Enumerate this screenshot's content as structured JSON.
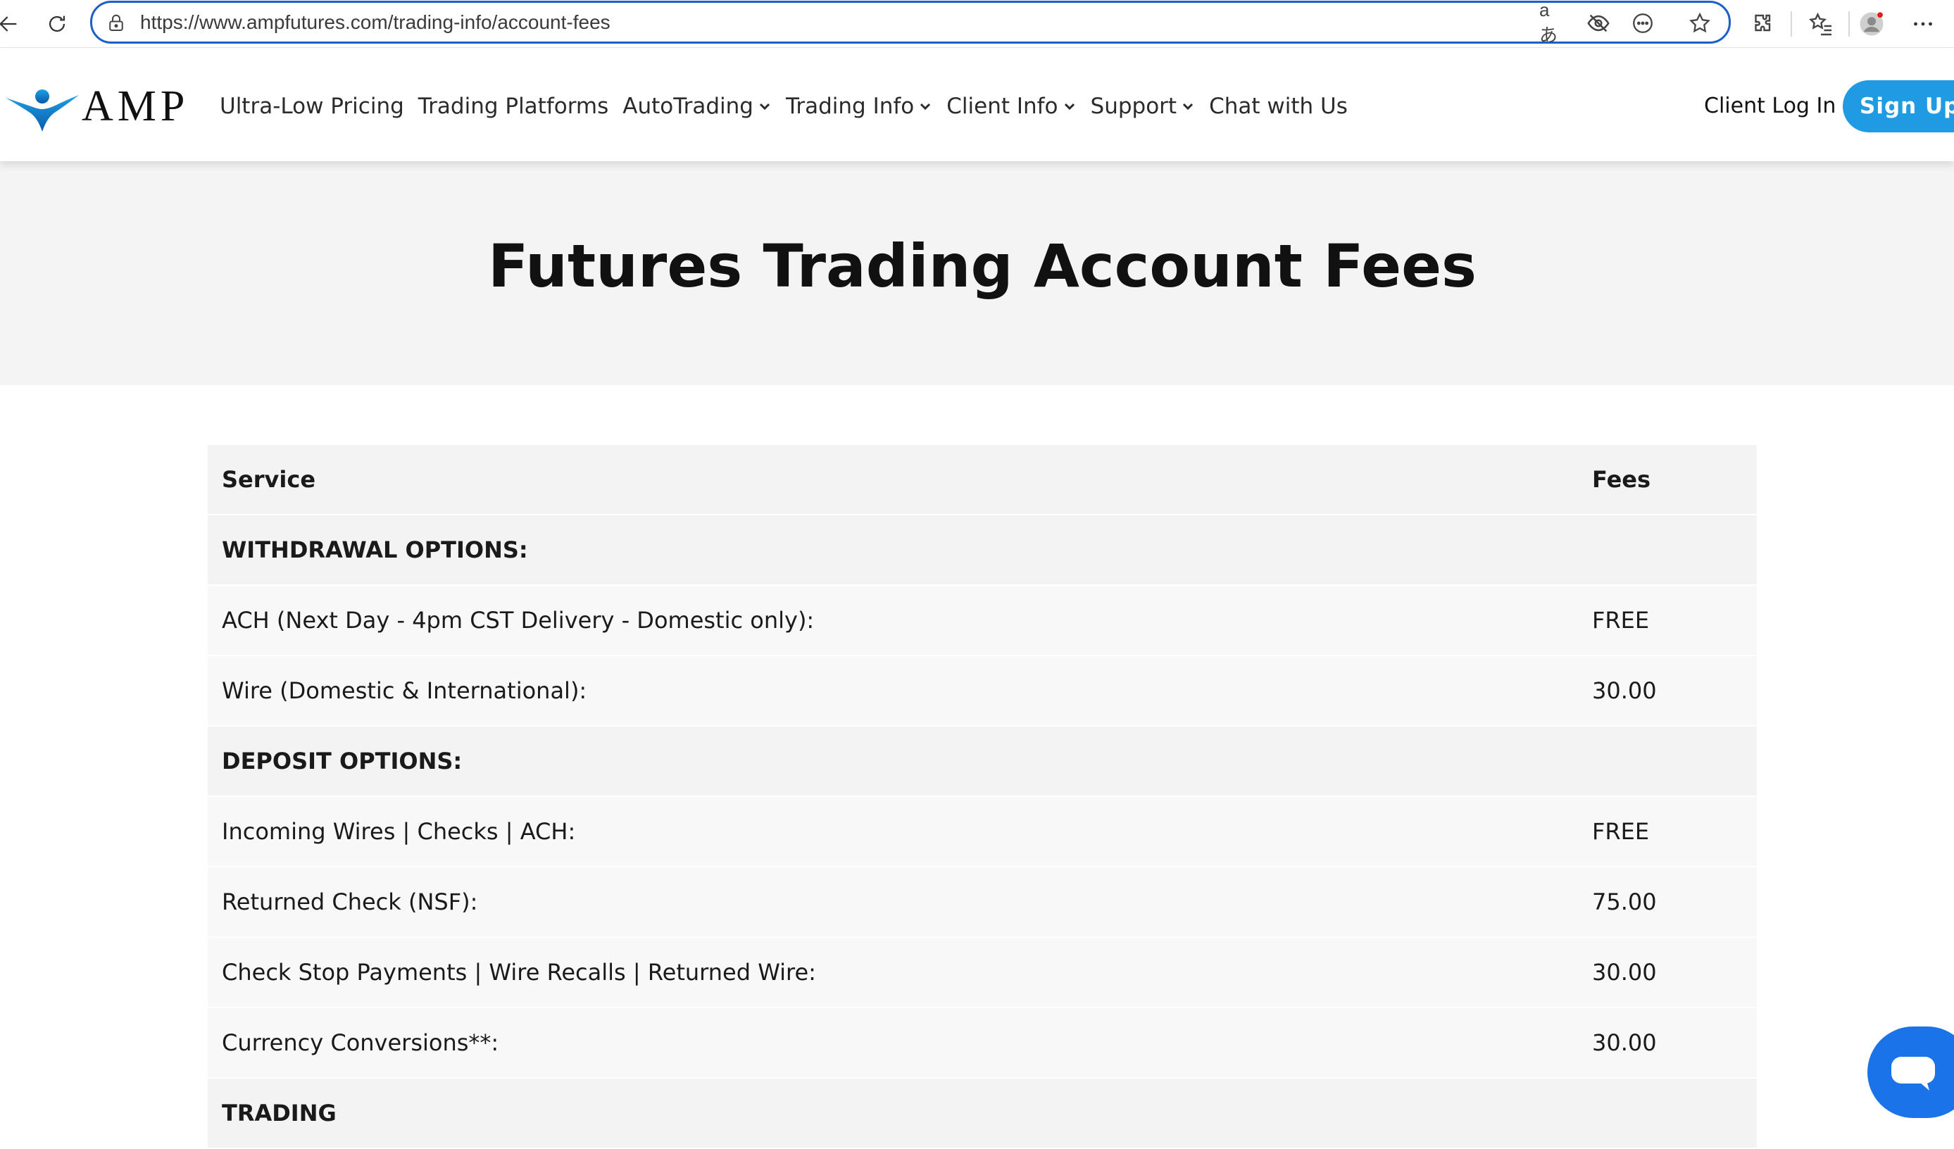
{
  "browser": {
    "url": "https://www.ampfutures.com/trading-info/account-fees",
    "translate_label": "aあ"
  },
  "site": {
    "logo_text": "AMP",
    "nav": [
      {
        "label": "Ultra-Low Pricing",
        "dropdown": false
      },
      {
        "label": "Trading Platforms",
        "dropdown": false
      },
      {
        "label": "AutoTrading",
        "dropdown": true
      },
      {
        "label": "Trading Info",
        "dropdown": true
      },
      {
        "label": "Client Info",
        "dropdown": true
      },
      {
        "label": "Support",
        "dropdown": true
      },
      {
        "label": "Chat with Us",
        "dropdown": false
      }
    ],
    "client_login": "Client Log In",
    "signup": "Sign Up",
    "accent_color": "#1e9be3"
  },
  "page": {
    "title": "Futures Trading Account Fees"
  },
  "table": {
    "header": {
      "service": "Service",
      "fees": "Fees"
    },
    "rows": [
      {
        "service": "WITHDRAWAL OPTIONS:",
        "fee": "",
        "section": true
      },
      {
        "service": "ACH (Next Day - 4pm CST Delivery - Domestic only):",
        "fee": "FREE",
        "section": false
      },
      {
        "service": "Wire (Domestic & International):",
        "fee": "30.00",
        "section": false
      },
      {
        "service": "DEPOSIT OPTIONS:",
        "fee": "",
        "section": true
      },
      {
        "service": "Incoming Wires | Checks | ACH:",
        "fee": "FREE",
        "section": false
      },
      {
        "service": "Returned Check (NSF):",
        "fee": "75.00",
        "section": false
      },
      {
        "service": "Check Stop Payments | Wire Recalls | Returned Wire:",
        "fee": "30.00",
        "section": false
      },
      {
        "service": "Currency Conversions**:",
        "fee": "30.00",
        "section": false
      },
      {
        "service": "TRADING",
        "fee": "",
        "section": true
      }
    ]
  }
}
